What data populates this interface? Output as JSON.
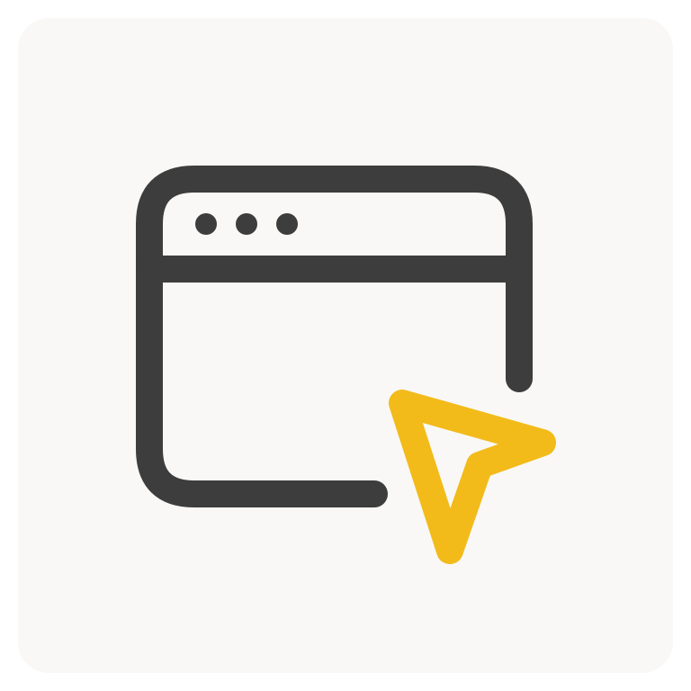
{
  "icon": {
    "name": "browser-window-cursor-icon",
    "parts": [
      "browser-window-icon",
      "window-dots-icon",
      "cursor-arrow-icon"
    ]
  },
  "colors": {
    "background": "#ffffff",
    "tile": "#f9f8f6",
    "stroke": "#3d3d3d",
    "accent": "#f2bb1a"
  }
}
